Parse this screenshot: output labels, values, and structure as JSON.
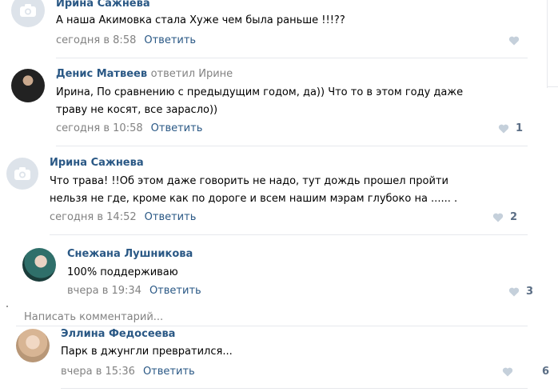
{
  "comments": [
    {
      "author": "Ирина Сажнева",
      "text": [
        "А наша Акимовка стала Хуже чем была раньше !!!??"
      ],
      "time": "сегодня в 8:58",
      "reply_label": "Ответить",
      "likes": ""
    },
    {
      "author": "Денис Матвеев",
      "reply_to": "ответил Ирине",
      "text": [
        "Ирина, По сравнению с предыдущим годом, да)) Что то в этом году даже",
        "траву не косят, все зарасло))"
      ],
      "time": "сегодня в 10:58",
      "reply_label": "Ответить",
      "likes": "1"
    },
    {
      "author": "Ирина Сажнева",
      "text": [
        "Что трава! !!Об этом даже говорить не надо, тут дождь прошел пройти",
        "нельзя не где, кроме как по дороге и всем нашим мэрам глубоко на ...... ."
      ],
      "time": "сегодня в 14:52",
      "reply_label": "Ответить",
      "likes": "2"
    },
    {
      "author": "Снежана Лушникова",
      "text": [
        "100% поддерживаю"
      ],
      "time": "вчера в 19:34",
      "reply_label": "Ответить",
      "likes": "3"
    },
    {
      "author": "Эллина Федосеева",
      "text": [
        "Парк в джунгли превратился..."
      ],
      "time": "вчера в 15:36",
      "reply_label": "Ответить",
      "likes": "6"
    }
  ],
  "write_comment_placeholder": "Написать комментарий...",
  "icons": {
    "like": "heart-icon",
    "no_photo": "camera-icon"
  },
  "colors": {
    "link": "#2a5885",
    "meta": "#828282",
    "heart": "#c5d0db",
    "divider": "#e7e8ec"
  }
}
